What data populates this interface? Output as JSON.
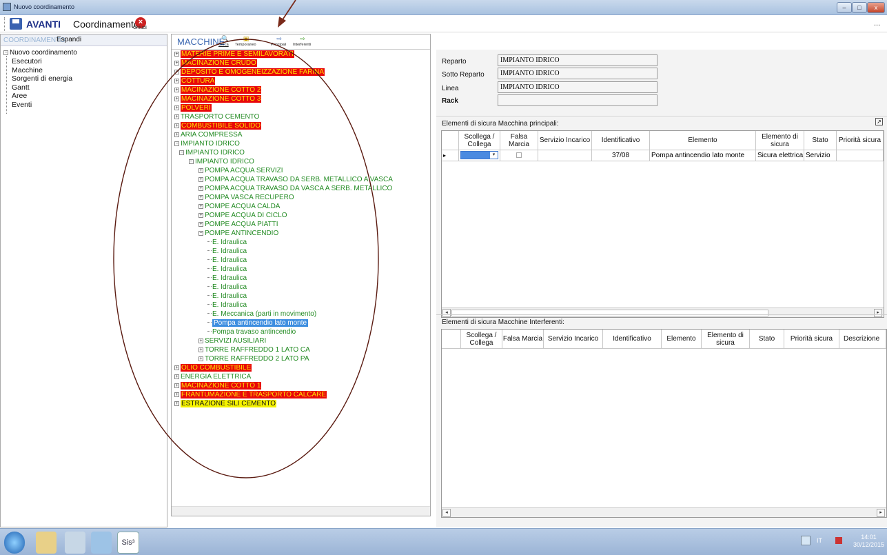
{
  "window": {
    "title": "Nuovo coordinamento",
    "controls": {
      "minimize": "–",
      "maximize": "□",
      "close": "x"
    }
  },
  "toolbar": {
    "avanti": "AVANTI",
    "coordinamento": "Coordinamento",
    "chiudi": "Chiudi",
    "more": "..."
  },
  "left_panel": {
    "header": "COORDINAMENTO",
    "expand": "Espandi",
    "root": "Nuovo coordinamento",
    "items": [
      "Esecutori",
      "Macchine",
      "Sorgenti di energia",
      "Gantt",
      "Aree",
      "Eventi"
    ]
  },
  "middle_panel": {
    "title": "MACCHINE",
    "tools": [
      {
        "label": "Cerca",
        "icon": "binoculars-icon"
      },
      {
        "label": "Temporaneo",
        "icon": "lock-icon"
      },
      {
        "label": "Principali",
        "icon": "arrow-right-icon"
      },
      {
        "label": "Interferenti",
        "icon": "arrow-right-icon"
      }
    ],
    "tree": [
      {
        "text": "MATERIE PRIME E SEMILAVORATI",
        "style": "red",
        "level": 0,
        "expander": "+"
      },
      {
        "text": "MACINAZIONE CRUDO",
        "style": "red",
        "level": 0,
        "expander": "+"
      },
      {
        "text": "DEPOSITO E OMOGENEIZZAZIONE FARINA",
        "style": "red",
        "level": 0,
        "expander": "+"
      },
      {
        "text": "COTTURA",
        "style": "red",
        "level": 0,
        "expander": "+"
      },
      {
        "text": "MACINAZIONE COTTO 2",
        "style": "red",
        "level": 0,
        "expander": "+"
      },
      {
        "text": "MACINAZIONE COTTO 3",
        "style": "red",
        "level": 0,
        "expander": "+"
      },
      {
        "text": "POLVERI",
        "style": "red",
        "level": 0,
        "expander": "+"
      },
      {
        "text": "TRASPORTO CEMENTO",
        "style": "green",
        "level": 0,
        "expander": "+"
      },
      {
        "text": "COMBUSTIBILE SOLIDO",
        "style": "red",
        "level": 0,
        "expander": "+"
      },
      {
        "text": "ARIA COMPRESSA",
        "style": "green",
        "level": 0,
        "expander": "+"
      },
      {
        "text": "IMPIANTO IDRICO",
        "style": "green",
        "level": 0,
        "expander": "−"
      },
      {
        "text": "IMPIANTO IDRICO",
        "style": "green",
        "level": 1,
        "expander": "−"
      },
      {
        "text": "IMPIANTO IDRICO",
        "style": "green",
        "level": 2,
        "expander": "−"
      },
      {
        "text": "POMPA ACQUA SERVIZI",
        "style": "green",
        "level": 3,
        "expander": "+"
      },
      {
        "text": "POMPA ACQUA TRAVASO DA SERB. METALLICO A VASCA",
        "style": "green",
        "level": 3,
        "expander": "+"
      },
      {
        "text": "POMPA ACQUA TRAVASO DA VASCA A SERB. METALLICO",
        "style": "green",
        "level": 3,
        "expander": "+"
      },
      {
        "text": "POMPA VASCA RECUPERO",
        "style": "green",
        "level": 3,
        "expander": "+"
      },
      {
        "text": "POMPE ACQUA CALDA",
        "style": "green",
        "level": 3,
        "expander": "+"
      },
      {
        "text": "POMPE ACQUA DI CICLO",
        "style": "green",
        "level": 3,
        "expander": "+"
      },
      {
        "text": "POMPE ACQUA PIATTI",
        "style": "green",
        "level": 3,
        "expander": "+"
      },
      {
        "text": "POMPE ANTINCENDIO",
        "style": "green",
        "level": 3,
        "expander": "−"
      },
      {
        "text": "E. Idraulica",
        "style": "green",
        "level": 4,
        "expander": ""
      },
      {
        "text": "E. Idraulica",
        "style": "green",
        "level": 4,
        "expander": ""
      },
      {
        "text": "E. Idraulica",
        "style": "green",
        "level": 4,
        "expander": ""
      },
      {
        "text": "E. Idraulica",
        "style": "green",
        "level": 4,
        "expander": ""
      },
      {
        "text": "E. Idraulica",
        "style": "green",
        "level": 4,
        "expander": ""
      },
      {
        "text": "E. Idraulica",
        "style": "green",
        "level": 4,
        "expander": ""
      },
      {
        "text": "E. Idraulica",
        "style": "green",
        "level": 4,
        "expander": ""
      },
      {
        "text": "E. Idraulica",
        "style": "green",
        "level": 4,
        "expander": ""
      },
      {
        "text": "E. Meccanica (parti in movimento)",
        "style": "green",
        "level": 4,
        "expander": ""
      },
      {
        "text": "Pompa antincendio lato monte",
        "style": "selected",
        "level": 4,
        "expander": ""
      },
      {
        "text": "Pompa travaso antincendio",
        "style": "green",
        "level": 4,
        "expander": ""
      },
      {
        "text": "SERVIZI AUSILIARI",
        "style": "green",
        "level": 3,
        "expander": "+"
      },
      {
        "text": "TORRE RAFFREDDO  1  LATO CA",
        "style": "green",
        "level": 3,
        "expander": "+"
      },
      {
        "text": "TORRE RAFFREDDO 2  LATO PA",
        "style": "green",
        "level": 3,
        "expander": "+"
      },
      {
        "text": "OLIO COMBUSTIBILE",
        "style": "red",
        "level": 0,
        "expander": "+"
      },
      {
        "text": "ENERGIA ELETTRICA",
        "style": "green",
        "level": 0,
        "expander": "+"
      },
      {
        "text": "MACINAZIONE COTTO 1",
        "style": "red",
        "level": 0,
        "expander": "+"
      },
      {
        "text": "FRANTUMAZIONE E TRASPORTO CALCARE",
        "style": "red",
        "level": 0,
        "expander": "+"
      },
      {
        "text": "ESTRAZIONE SILI CEMENTO",
        "style": "yellow",
        "level": 0,
        "expander": "+"
      }
    ]
  },
  "details": {
    "reparto_label": "Reparto",
    "reparto": "IMPIANTO IDRICO",
    "sotto_label": "Sotto Reparto",
    "sotto": "IMPIANTO IDRICO",
    "linea_label": "Linea",
    "linea": "IMPIANTO IDRICO",
    "rack_label": "Rack",
    "rack": ""
  },
  "grid_principali": {
    "title": "Elementi di sicura Macchina  principali:",
    "columns": [
      "Scollega / Collega",
      "Falsa Marcia",
      "Servizio Incarico",
      "Identificativo",
      "Elemento",
      "Elemento di sicura",
      "Stato",
      "Priorità sicura"
    ],
    "rows": [
      {
        "identificativo": "37/08",
        "elemento": "Pompa antincendio lato monte",
        "elemento_sicura": "Sicura elettrica",
        "stato": "Servizio"
      }
    ]
  },
  "grid_interferenti": {
    "title": "Elementi di sicura Macchine Interferenti:",
    "columns": [
      "Scollega / Collega",
      "Falsa Marcia",
      "Servizio Incarico",
      "Identificativo",
      "Elemento",
      "Elemento di sicura",
      "Stato",
      "Priorità sicura",
      "Descrizione"
    ]
  },
  "taskbar": {
    "lang": "IT",
    "time": "14:01",
    "date": "30/12/2015",
    "app_label": "Sis³"
  },
  "colors": {
    "red_node": "#e8080a",
    "red_text": "#ffe000",
    "green_node": "#218a21",
    "yellow_node": "#f6f300",
    "selected": "#3d8ee0",
    "annotation": "#7a2a1a"
  }
}
